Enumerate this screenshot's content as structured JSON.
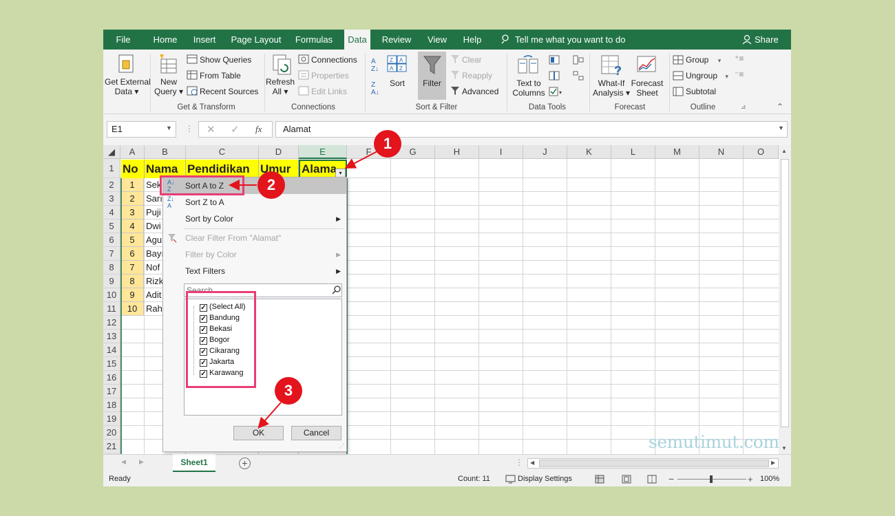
{
  "tabs": [
    "File",
    "Home",
    "Insert",
    "Page Layout",
    "Formulas",
    "Data",
    "Review",
    "View",
    "Help"
  ],
  "active_tab": "Data",
  "tell_me": "Tell me what you want to do",
  "share": "Share",
  "ribbon": {
    "get_external_1": "Get External",
    "get_external_2": "Data",
    "new_query_1": "New",
    "new_query_2": "Query",
    "show_queries": "Show Queries",
    "from_table": "From Table",
    "recent_sources": "Recent Sources",
    "group_get_transform": "Get & Transform",
    "refresh_1": "Refresh",
    "refresh_2": "All",
    "connections": "Connections",
    "properties": "Properties",
    "edit_links": "Edit Links",
    "group_connections": "Connections",
    "sort": "Sort",
    "filter": "Filter",
    "clear": "Clear",
    "reapply": "Reapply",
    "advanced": "Advanced",
    "group_sort_filter": "Sort & Filter",
    "text_to_columns_1": "Text to",
    "text_to_columns_2": "Columns",
    "group_data_tools": "Data Tools",
    "what_if_1": "What-If",
    "what_if_2": "Analysis",
    "forecast_sheet_1": "Forecast",
    "forecast_sheet_2": "Sheet",
    "group_forecast": "Forecast",
    "group_btn": "Group",
    "ungroup_btn": "Ungroup",
    "subtotal": "Subtotal",
    "group_outline": "Outline"
  },
  "name_box": "E1",
  "formula": "Alamat",
  "fx": "fx",
  "columns": [
    "A",
    "B",
    "C",
    "D",
    "E",
    "F",
    "G",
    "H",
    "I",
    "J",
    "K",
    "L",
    "M",
    "N",
    "O"
  ],
  "rows": [
    "1",
    "2",
    "3",
    "4",
    "5",
    "6",
    "7",
    "8",
    "9",
    "10",
    "11",
    "12",
    "13",
    "14",
    "15",
    "16",
    "17",
    "18",
    "19",
    "20",
    "21"
  ],
  "headers": {
    "no": "No",
    "nama": "Nama",
    "pendidikan": "Pendidikan",
    "umur": "Umur",
    "alamat": "Alama"
  },
  "numbers": [
    "1",
    "2",
    "3",
    "4",
    "5",
    "6",
    "7",
    "8",
    "9",
    "10"
  ],
  "names": [
    "Sek",
    "Sarı",
    "Puji",
    "Dwi",
    "Agu",
    "Bayı",
    "Nof",
    "Rizk",
    "Adit",
    "Rah"
  ],
  "menu": {
    "sort_az": "Sort A to Z",
    "sort_za": "Sort Z to A",
    "sort_color": "Sort by Color",
    "clear_filter": "Clear Filter From \"Alamat\"",
    "filter_color": "Filter by Color",
    "text_filters": "Text Filters",
    "search_placeholder": "Search",
    "items": [
      "(Select All)",
      "Bandung",
      "Bekasi",
      "Bogor",
      "Cikarang",
      "Jakarta",
      "Karawang"
    ],
    "ok": "OK",
    "cancel": "Cancel"
  },
  "callouts": [
    "1",
    "2",
    "3"
  ],
  "sheet_tab": "Sheet1",
  "status": {
    "ready": "Ready",
    "count": "Count: 11",
    "display_settings": "Display Settings",
    "zoom": "100%"
  },
  "watermark": "semutimut.com",
  "colors": {
    "excel_green": "#217346",
    "highlight_yellow": "#ffff00",
    "number_fill": "#ffe699",
    "callout_red": "#e3141c",
    "box_pink": "#e83e73"
  }
}
